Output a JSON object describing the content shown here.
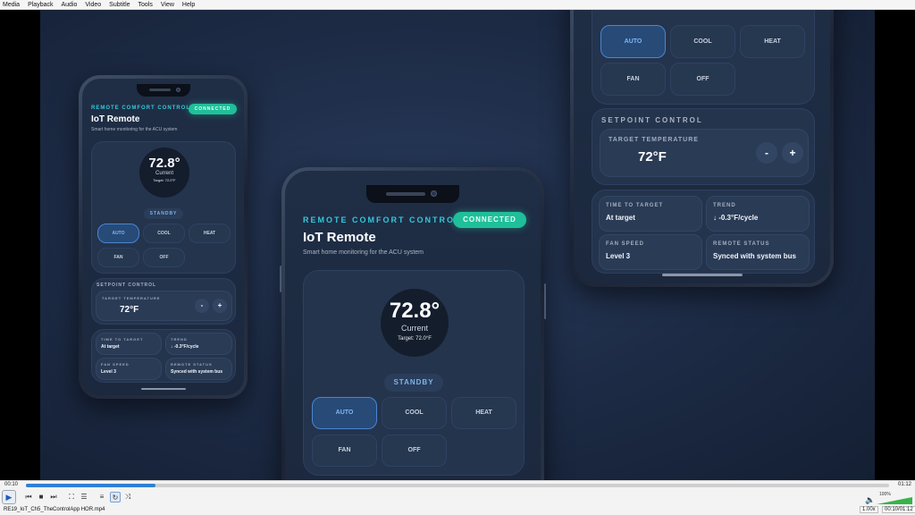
{
  "menu": [
    "Media",
    "Playback",
    "Audio",
    "Video",
    "Subtitle",
    "Tools",
    "View",
    "Help"
  ],
  "app": {
    "eyebrow": "REMOTE COMFORT CONTROL",
    "status": "CONNECTED",
    "title": "IoT Remote",
    "subtitle": "Smart home monitoring for the ACU system",
    "current_temp": "72.8°",
    "current_label": "Current",
    "target_small": "Target: 72.0°F",
    "state": "STANDBY",
    "modes": [
      "AUTO",
      "COOL",
      "HEAT",
      "FAN",
      "OFF"
    ],
    "active_mode": "AUTO",
    "setpoint_section": "SETPOINT CONTROL",
    "target_label": "TARGET TEMPERATURE",
    "target_value": "72°F",
    "minus": "-",
    "plus": "+",
    "stats": {
      "time_to_target_label": "TIME TO TARGET",
      "time_to_target_value": "At target",
      "trend_label": "TREND",
      "trend_value": "↓ -0.3°F/cycle",
      "fan_speed_label": "FAN SPEED",
      "fan_speed_value": "Level 3",
      "remote_status_label": "REMOTE STATUS",
      "remote_status_value": "Synced with system bus"
    }
  },
  "player": {
    "elapsed": "00:10",
    "total": "01:12",
    "progress": 0.15,
    "filename": "RE19_IoT_Ch5_TheControlApp HOR.mp4",
    "speed": "1.00x",
    "time_display": "00:10/01:12",
    "volume": "100%"
  },
  "colors": {
    "accent": "#35c7d9",
    "connected": "#1fbf9a",
    "active_mode": "#4a86d0",
    "seek_fill": "#2f7fd6"
  }
}
